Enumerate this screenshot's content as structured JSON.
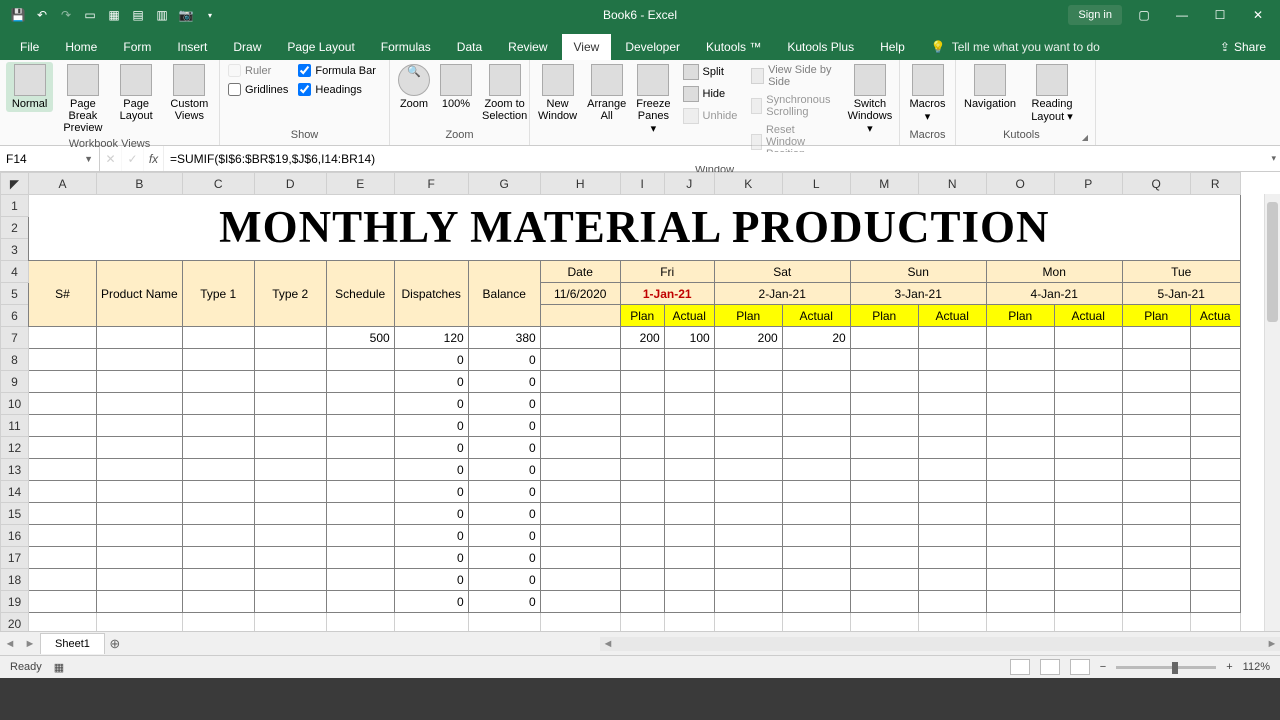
{
  "title": "Book6  -  Excel",
  "qat": [
    "save",
    "undo",
    "redo",
    "ruler",
    "page-layout",
    "preview",
    "table",
    "camera",
    "more"
  ],
  "signin": "Sign in",
  "tabs": [
    "File",
    "Home",
    "Form",
    "Insert",
    "Draw",
    "Page Layout",
    "Formulas",
    "Data",
    "Review",
    "View",
    "Developer",
    "Kutools ™",
    "Kutools Plus",
    "Help"
  ],
  "active_tab": "View",
  "tell_me": "Tell me what you want to do",
  "share": "Share",
  "ribbon": {
    "workbook_views": {
      "label": "Workbook Views",
      "items": [
        "Normal",
        "Page Break Preview",
        "Page Layout",
        "Custom Views"
      ]
    },
    "show": {
      "label": "Show",
      "checks": [
        {
          "label": "Ruler",
          "checked": false,
          "enabled": false
        },
        {
          "label": "Formula Bar",
          "checked": true,
          "enabled": true
        },
        {
          "label": "Gridlines",
          "checked": false,
          "enabled": true
        },
        {
          "label": "Headings",
          "checked": true,
          "enabled": true
        }
      ]
    },
    "zoom": {
      "label": "Zoom",
      "items": [
        "Zoom",
        "100%",
        "Zoom to Selection"
      ]
    },
    "window": {
      "label": "Window",
      "big": [
        "New Window",
        "Arrange All",
        "Freeze Panes ▾"
      ],
      "small": [
        "Split",
        "Hide",
        "Unhide",
        "View Side by Side",
        "Synchronous Scrolling",
        "Reset Window Position"
      ],
      "switch": "Switch Windows ▾"
    },
    "macros": {
      "label": "Macros",
      "item": "Macros ▾"
    },
    "kutools": {
      "label": "Kutools",
      "items": [
        "Navigation",
        "Reading Layout ▾"
      ]
    }
  },
  "namebox": "F14",
  "formula": "=SUMIF($I$6:$BR$19,$J$6,I14:BR14)",
  "columns": [
    "A",
    "B",
    "C",
    "D",
    "E",
    "F",
    "G",
    "H",
    "I",
    "J",
    "K",
    "L",
    "M",
    "N",
    "O",
    "P",
    "Q",
    "R"
  ],
  "sheet_title": "MONTHLY MATERIAL PRODUCTION",
  "head": {
    "s": "S#",
    "product": "Product Name",
    "t1": "Type 1",
    "t2": "Type 2",
    "sched": "Schedule",
    "disp": "Dispatches",
    "bal": "Balance",
    "date": "Date",
    "date_val": "11/6/2020",
    "days": [
      {
        "day": "Fri",
        "date": "1-Jan-21",
        "red": true
      },
      {
        "day": "Sat",
        "date": "2-Jan-21"
      },
      {
        "day": "Sun",
        "date": "3-Jan-21"
      },
      {
        "day": "Mon",
        "date": "4-Jan-21"
      },
      {
        "day": "Tue",
        "date": "5-Jan-21"
      }
    ],
    "plan": "Plan",
    "actual": "Actual",
    "actual_cut": "Actua"
  },
  "rows": [
    {
      "n": 7,
      "e": 500,
      "f": 120,
      "g": 380,
      "i": 200,
      "j": 100,
      "k": 200,
      "l": 20
    },
    {
      "n": 8,
      "f": 0,
      "g": 0
    },
    {
      "n": 9,
      "f": 0,
      "g": 0
    },
    {
      "n": 10,
      "f": 0,
      "g": 0
    },
    {
      "n": 11,
      "f": 0,
      "g": 0
    },
    {
      "n": 12,
      "f": 0,
      "g": 0
    },
    {
      "n": 13,
      "f": 0,
      "g": 0
    },
    {
      "n": 14,
      "f": 0,
      "g": 0
    },
    {
      "n": 15,
      "f": 0,
      "g": 0
    },
    {
      "n": 16,
      "f": 0,
      "g": 0
    },
    {
      "n": 17,
      "f": 0,
      "g": 0
    },
    {
      "n": 18,
      "f": 0,
      "g": 0
    },
    {
      "n": 19,
      "f": 0,
      "g": 0
    },
    {
      "n": 20
    }
  ],
  "sheet_tab": "Sheet1",
  "status": {
    "ready": "Ready",
    "zoom": "112%"
  }
}
